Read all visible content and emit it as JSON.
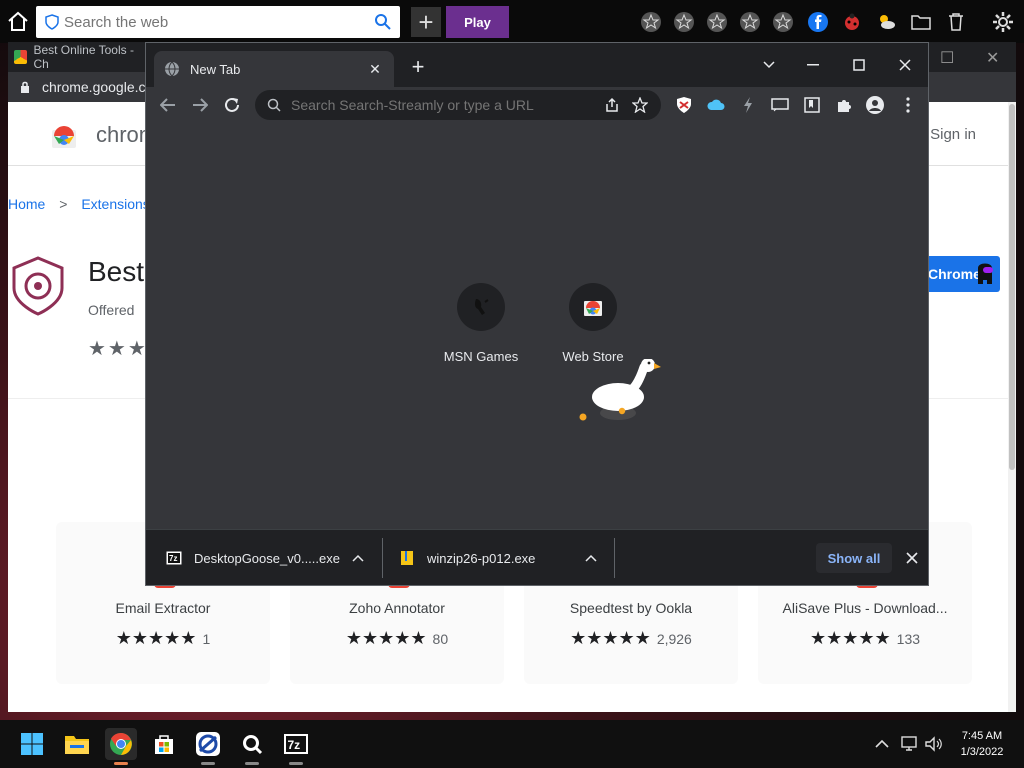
{
  "top_toolbar": {
    "search_placeholder": "Search the web",
    "play_label": "Play",
    "plus_label": "+"
  },
  "bg_window": {
    "tab_title": "Best Online Tools - Ch",
    "address": "chrome.google.c",
    "store_name": "chrom",
    "sign_in": "Sign in",
    "breadcrumb": [
      "Home",
      "Extensions"
    ],
    "breadcrumb_sep": ">",
    "extension_title": "Best",
    "offered_by": "Offered",
    "add_button": "Chrome",
    "stars": "★★★",
    "cards": [
      {
        "name": "Email Extractor",
        "stars": "★★★★★",
        "count": "1"
      },
      {
        "name": "Zoho Annotator",
        "stars": "★★★★★",
        "count": "80"
      },
      {
        "name": "Speedtest by Ookla",
        "stars": "★★★★★",
        "count": "2,926"
      },
      {
        "name": "AliSave Plus - Download...",
        "stars": "★★★★★",
        "count": "133"
      }
    ]
  },
  "fg_window": {
    "tab_title": "New Tab",
    "omnibox_placeholder": "Search Search-Streamly or type a URL",
    "shortcuts": [
      {
        "label": "MSN Games"
      },
      {
        "label": "Web Store"
      }
    ],
    "downloads": [
      {
        "filename": "DesktopGoose_v0.....exe"
      },
      {
        "filename": "winzip26-p012.exe"
      }
    ],
    "show_all_label": "Show all"
  },
  "taskbar": {
    "time": "7:45 AM",
    "date": "1/3/2022"
  },
  "colors": {
    "play_button": "#6b2f8f",
    "chrome_dark": "#35363a",
    "chrome_darker": "#202124",
    "link_blue": "#1a73e8",
    "show_all_blue": "#8ab4f8"
  }
}
